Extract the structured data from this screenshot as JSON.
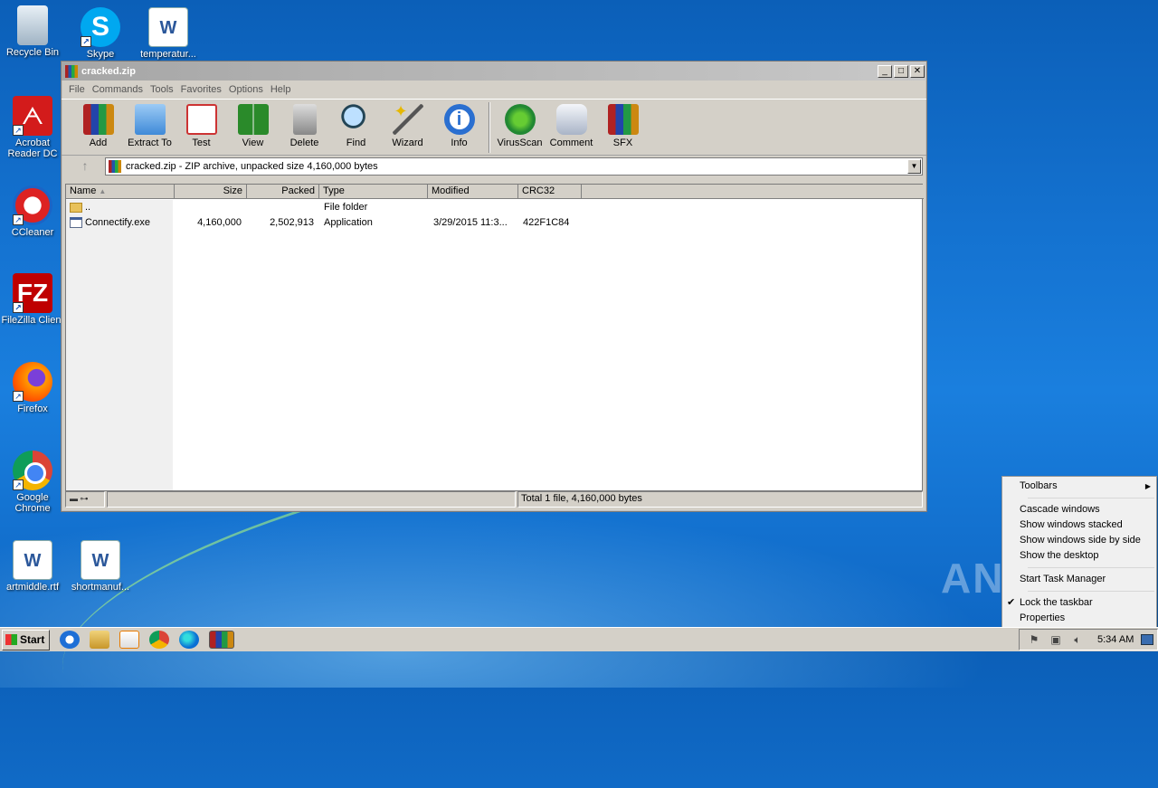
{
  "desktop": {
    "icons": [
      {
        "label": "Recycle Bin",
        "icon": "recycle-bin-icon"
      },
      {
        "label": "Skype",
        "icon": "skype-icon"
      },
      {
        "label": "temperatur...",
        "icon": "word-doc-icon"
      },
      {
        "label": "Acrobat Reader DC",
        "icon": "acrobat-icon"
      },
      {
        "label": "CCleaner",
        "icon": "ccleaner-icon"
      },
      {
        "label": "FileZilla Client",
        "icon": "filezilla-icon"
      },
      {
        "label": "Firefox",
        "icon": "firefox-icon"
      },
      {
        "label": "Google Chrome",
        "icon": "chrome-icon"
      },
      {
        "label": "artmiddle.rtf",
        "icon": "word-doc-icon"
      },
      {
        "label": "shortmanuf...",
        "icon": "word-doc-icon"
      }
    ]
  },
  "window": {
    "title": "cracked.zip",
    "menu": [
      "File",
      "Commands",
      "Tools",
      "Favorites",
      "Options",
      "Help"
    ],
    "toolbar": [
      "Add",
      "Extract To",
      "Test",
      "View",
      "Delete",
      "Find",
      "Wizard",
      "Info",
      "VirusScan",
      "Comment",
      "SFX"
    ],
    "address": "cracked.zip - ZIP archive, unpacked size 4,160,000 bytes",
    "columns": [
      "Name",
      "Size",
      "Packed",
      "Type",
      "Modified",
      "CRC32"
    ],
    "rows": [
      {
        "name": "..",
        "size": "",
        "packed": "",
        "type": "File folder",
        "modified": "",
        "crc": ""
      },
      {
        "name": "Connectify.exe",
        "size": "4,160,000",
        "packed": "2,502,913",
        "type": "Application",
        "modified": "3/29/2015 11:3...",
        "crc": "422F1C84"
      }
    ],
    "status": "Total 1 file, 4,160,000 bytes"
  },
  "context_menu": {
    "toolbars": "Toolbars",
    "cascade": "Cascade windows",
    "stacked": "Show windows stacked",
    "side": "Show windows side by side",
    "desktop": "Show the desktop",
    "task_manager": "Start Task Manager",
    "lock": "Lock the taskbar",
    "properties": "Properties"
  },
  "watermark": "ANY.RUN",
  "taskbar": {
    "start": "Start",
    "clock": "5:34 AM"
  }
}
